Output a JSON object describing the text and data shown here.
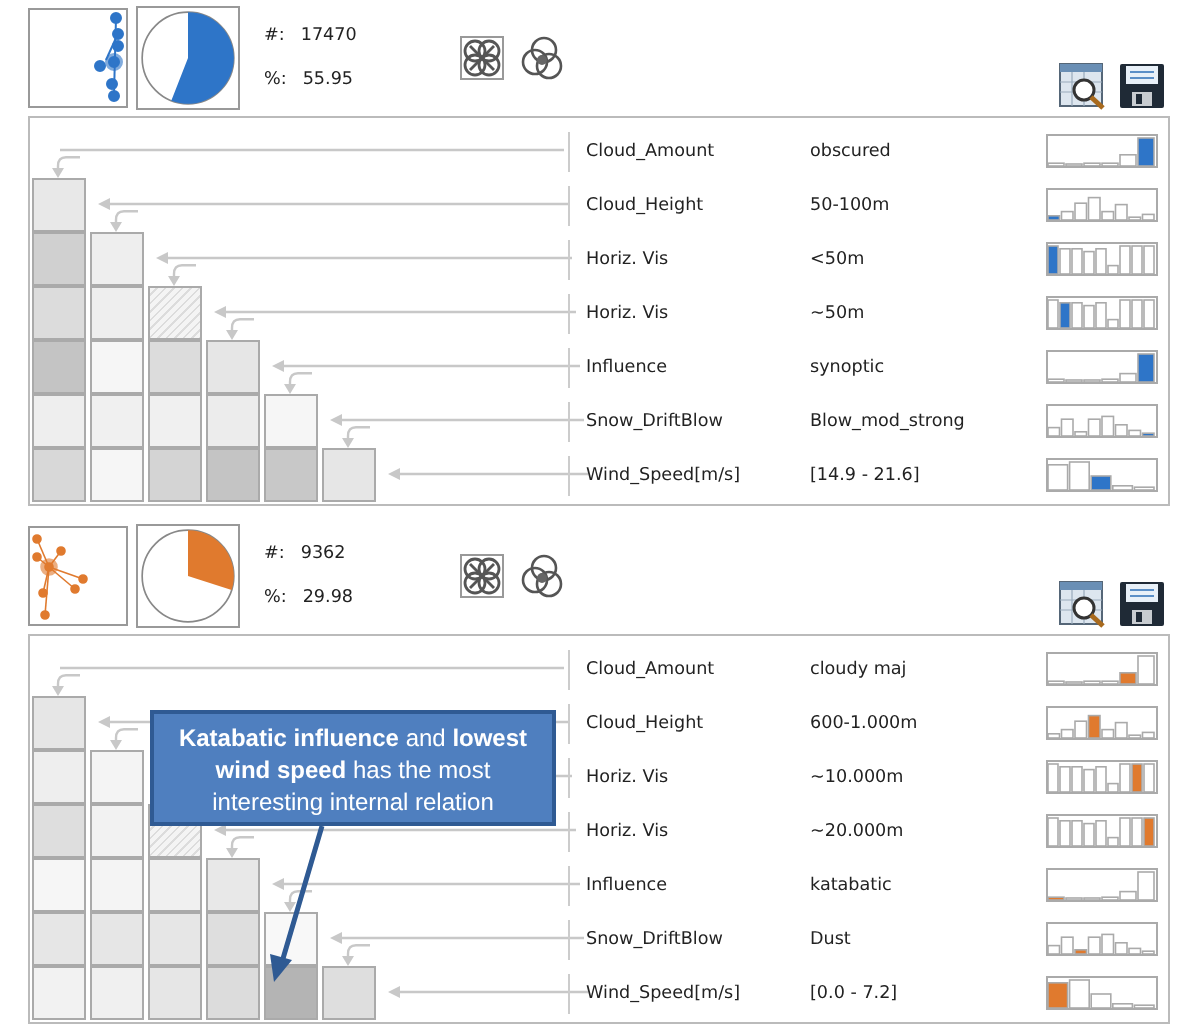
{
  "panels": [
    {
      "color": "#2e75c8",
      "count_label": "#:",
      "count": "17470",
      "percent_label": "%:",
      "percent": "55.95",
      "rows": [
        {
          "attribute": "Cloud_Amount",
          "value": "obscured",
          "cells": []
        },
        {
          "attribute": "Cloud_Height",
          "value": "50-100m",
          "cells": [
            {
              "kind": "solid",
              "color": "#e8e8e8"
            }
          ]
        },
        {
          "attribute": "Horiz. Vis",
          "value": "<50m",
          "cells": [
            {
              "kind": "solid",
              "color": "#d0d0d0"
            },
            {
              "kind": "solid",
              "color": "#eeeeee"
            }
          ]
        },
        {
          "attribute": "Horiz. Vis",
          "value": "~50m",
          "cells": [
            {
              "kind": "solid",
              "color": "#dcdcdc"
            },
            {
              "kind": "solid",
              "color": "#eeeeee"
            },
            {
              "kind": "hatched"
            }
          ]
        },
        {
          "attribute": "Influence",
          "value": "synoptic",
          "cells": [
            {
              "kind": "solid",
              "color": "#c4c4c4"
            },
            {
              "kind": "solid",
              "color": "#f6f6f6"
            },
            {
              "kind": "solid",
              "color": "#dcdcdc"
            },
            {
              "kind": "solid",
              "color": "#e6e6e6"
            }
          ]
        },
        {
          "attribute": "Snow_DriftBlow",
          "value": "Blow_mod_strong",
          "cells": [
            {
              "kind": "solid",
              "color": "#eeeeee"
            },
            {
              "kind": "solid",
              "color": "#f0f0f0"
            },
            {
              "kind": "solid",
              "color": "#f0f0f0"
            },
            {
              "kind": "solid",
              "color": "#ececec"
            },
            {
              "kind": "solid",
              "color": "#f6f6f6"
            }
          ]
        },
        {
          "attribute": "Wind_Speed[m/s]",
          "value": "[14.9 - 21.6]",
          "cells": [
            {
              "kind": "solid",
              "color": "#d8d8d8"
            },
            {
              "kind": "solid",
              "color": "#f6f6f6"
            },
            {
              "kind": "solid",
              "color": "#d4d4d4"
            },
            {
              "kind": "solid",
              "color": "#c4c4c4"
            },
            {
              "kind": "solid",
              "color": "#c8c8c8"
            },
            {
              "kind": "solid",
              "color": "#e6e6e6"
            }
          ]
        }
      ]
    },
    {
      "color": "#e07a2e",
      "count_label": "#:",
      "count": "9362",
      "percent_label": "%:",
      "percent": "29.98",
      "callout": "**Katabatic influence** and **lowest wind speed** has the most interesting internal relation",
      "rows": [
        {
          "attribute": "Cloud_Amount",
          "value": "cloudy maj",
          "cells": []
        },
        {
          "attribute": "Cloud_Height",
          "value": "600-1.000m",
          "cells": [
            {
              "kind": "solid",
              "color": "#e6e6e6"
            }
          ]
        },
        {
          "attribute": "Horiz. Vis",
          "value": "~10.000m",
          "cells": [
            {
              "kind": "solid",
              "color": "#eeeeee"
            },
            {
              "kind": "solid",
              "color": "#f4f4f4"
            }
          ]
        },
        {
          "attribute": "Horiz. Vis",
          "value": "~20.000m",
          "cells": [
            {
              "kind": "solid",
              "color": "#dedede"
            },
            {
              "kind": "solid",
              "color": "#f2f2f2"
            },
            {
              "kind": "hatched"
            }
          ]
        },
        {
          "attribute": "Influence",
          "value": "katabatic",
          "cells": [
            {
              "kind": "solid",
              "color": "#f6f6f6"
            },
            {
              "kind": "solid",
              "color": "#f4f4f4"
            },
            {
              "kind": "solid",
              "color": "#f0f0f0"
            },
            {
              "kind": "solid",
              "color": "#e8e8e8"
            }
          ]
        },
        {
          "attribute": "Snow_DriftBlow",
          "value": "Dust",
          "cells": [
            {
              "kind": "solid",
              "color": "#e6e6e6"
            },
            {
              "kind": "solid",
              "color": "#e6e6e6"
            },
            {
              "kind": "solid",
              "color": "#e6e6e6"
            },
            {
              "kind": "solid",
              "color": "#dedede"
            },
            {
              "kind": "solid",
              "color": "#f8f8f8"
            }
          ]
        },
        {
          "attribute": "Wind_Speed[m/s]",
          "value": "[0.0 - 7.2]",
          "cells": [
            {
              "kind": "solid",
              "color": "#f2f2f2"
            },
            {
              "kind": "solid",
              "color": "#f0f0f0"
            },
            {
              "kind": "solid",
              "color": "#e6e6e6"
            },
            {
              "kind": "solid",
              "color": "#dcdcdc"
            },
            {
              "kind": "solid",
              "color": "#b4b4b4"
            },
            {
              "kind": "solid",
              "color": "#dedede"
            }
          ]
        }
      ]
    }
  ]
}
